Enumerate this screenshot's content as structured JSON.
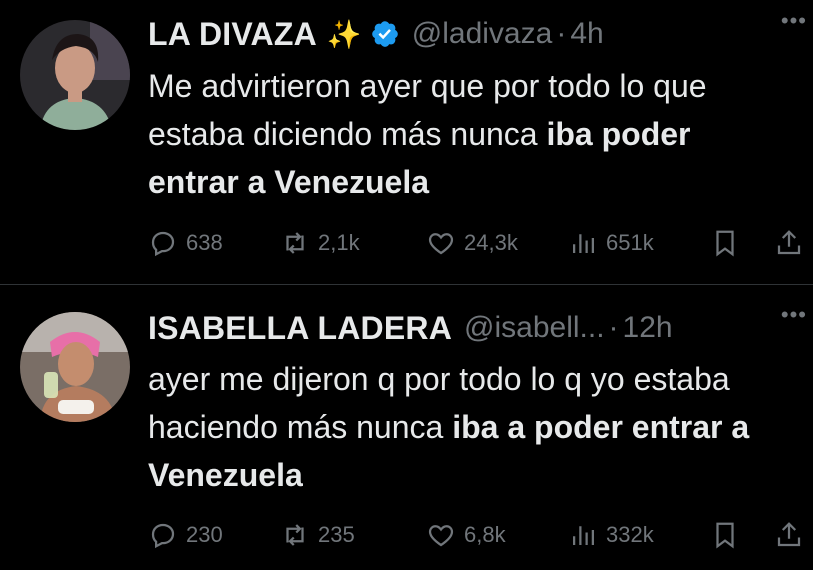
{
  "tweets": [
    {
      "name": "LA DIVAZA",
      "sparkle": "✨",
      "handle": "@ladivaza",
      "time": "4h",
      "text_plain": "Me advirtieron ayer que por todo lo que estaba diciendo más nunca ",
      "text_bold": "iba poder entrar a Venezuela",
      "replies": "638",
      "retweets": "2,1k",
      "likes": "24,3k",
      "views": "651k"
    },
    {
      "name": "ISABELLA LADERA",
      "handle": "@isabell...",
      "time": "12h",
      "text_plain": "ayer me dijeron q por todo lo q yo estaba haciendo más nunca ",
      "text_bold": "iba a poder entrar a Venezuela",
      "replies": "230",
      "retweets": "235",
      "likes": "6,8k",
      "views": "332k"
    }
  ],
  "colors": {
    "background": "#000000",
    "text": "#e7e9ea",
    "muted": "#71767b",
    "verified": "#1d9bf0",
    "divider": "#2f3336"
  },
  "icons": [
    "reply-icon",
    "retweet-icon",
    "like-icon",
    "views-icon",
    "bookmark-icon",
    "share-icon",
    "verified-icon",
    "more-icon"
  ]
}
